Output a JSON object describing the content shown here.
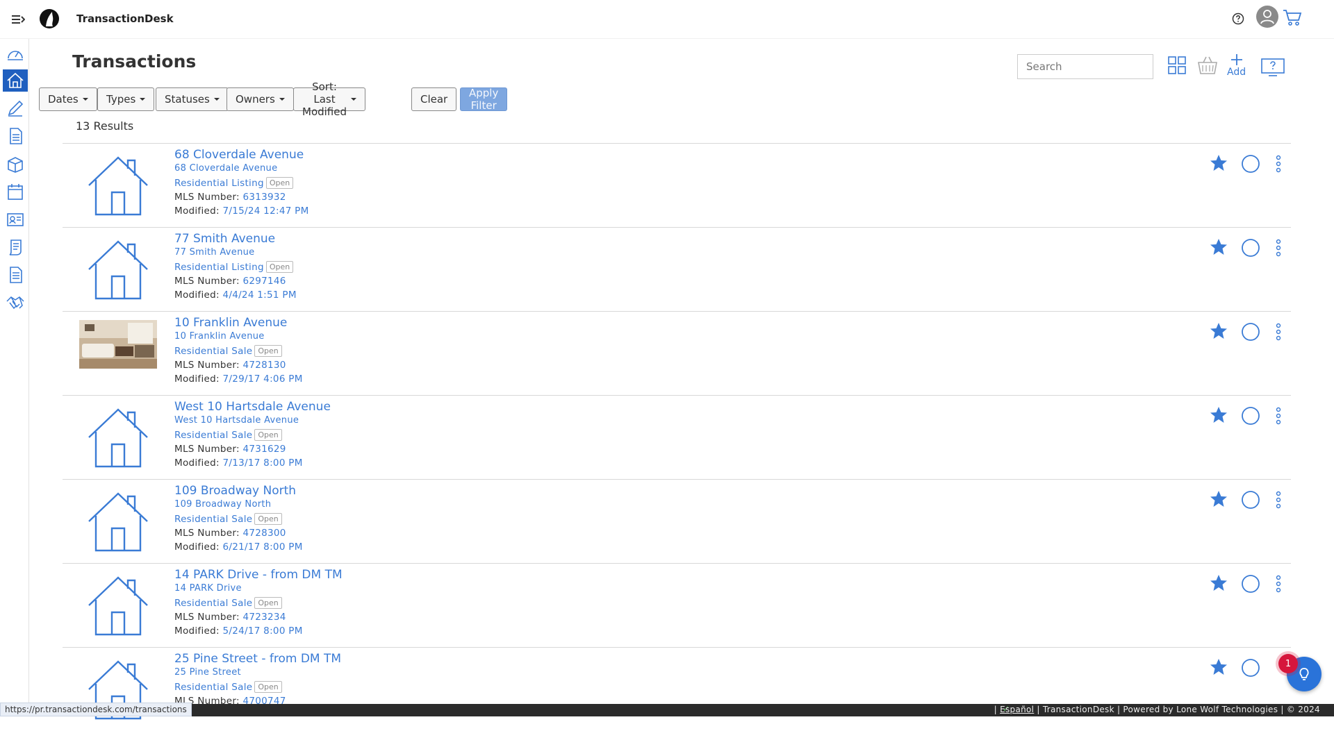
{
  "app": {
    "title": "TransactionDesk"
  },
  "page": {
    "title": "Transactions",
    "results": "13 Results"
  },
  "search": {
    "placeholder": "Search"
  },
  "header_actions": {
    "add_label": "Add"
  },
  "filters": {
    "dates": "Dates",
    "types": "Types",
    "statuses": "Statuses",
    "owners": "Owners",
    "sort": "Sort: Last Modified",
    "clear": "Clear",
    "apply": "Apply Filter"
  },
  "labels": {
    "mls": "MLS Number: ",
    "modified": "Modified: "
  },
  "transactions": [
    {
      "title": "68 Cloverdale Avenue",
      "address": "68 Cloverdale Avenue",
      "type": "Residential Listing",
      "status": "Open",
      "mls": "6313932",
      "modified": "7/15/24 12:47 PM",
      "thumb": "house-icon"
    },
    {
      "title": "77 Smith Avenue",
      "address": "77 Smith Avenue",
      "type": "Residential Listing",
      "status": "Open",
      "mls": "6297146",
      "modified": "4/4/24 1:51 PM",
      "thumb": "house-icon"
    },
    {
      "title": "10 Franklin Avenue",
      "address": "10 Franklin Avenue",
      "type": "Residential Sale",
      "status": "Open",
      "mls": "4728130",
      "modified": "7/29/17 4:06 PM",
      "thumb": "property-photo"
    },
    {
      "title": "West 10 Hartsdale Avenue",
      "address": "West 10 Hartsdale Avenue",
      "type": "Residential Sale",
      "status": "Open",
      "mls": "4731629",
      "modified": "7/13/17 8:00 PM",
      "thumb": "house-icon"
    },
    {
      "title": "109 Broadway North",
      "address": "109 Broadway North",
      "type": "Residential Sale",
      "status": "Open",
      "mls": "4728300",
      "modified": "6/21/17 8:00 PM",
      "thumb": "house-icon"
    },
    {
      "title": "14 PARK Drive - from DM TM",
      "address": "14 PARK Drive",
      "type": "Residential Sale",
      "status": "Open",
      "mls": "4723234",
      "modified": "5/24/17 8:00 PM",
      "thumb": "house-icon"
    },
    {
      "title": "25 Pine Street - from DM TM",
      "address": "25 Pine Street",
      "type": "Residential Sale",
      "status": "Open",
      "mls": "4700747",
      "modified": "",
      "thumb": "house-icon"
    }
  ],
  "notifications": {
    "count": "1"
  },
  "status_bar": {
    "url": "https://pr.transactiondesk.com/transactions"
  },
  "footer": {
    "lang": "Español",
    "rest": " | TransactionDesk | Powered by Lone Wolf Technologies | © 2024",
    "sep": "| "
  },
  "colors": {
    "accent": "#3a7bd5",
    "active_nav": "#1f5fbf",
    "badge": "#d6163c"
  }
}
